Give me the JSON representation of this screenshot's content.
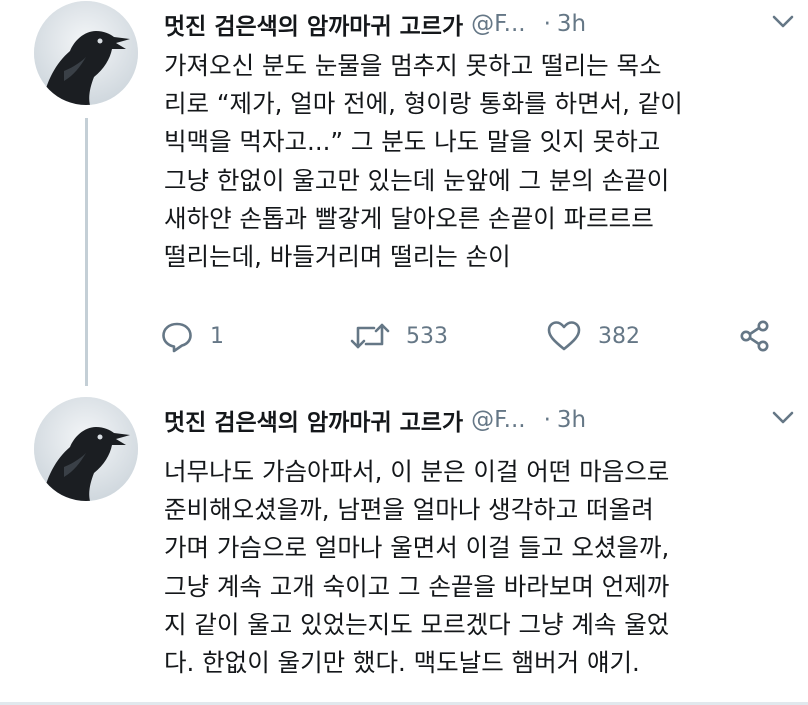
{
  "tweets": [
    {
      "display_name": "멋진 검은색의 암까마귀 고르가",
      "handle": "@F...",
      "separator": "·",
      "time": "3h",
      "text": "가져오신 분도 눈물을 멈추지 못하고 떨리는 목소\n리로 “제가, 얼마 전에, 형이랑 통화를 하면서, 같이\n빅맥을 먹자고...” 그 분도 나도 말을 잇지 못하고\n그냥 한없이 울고만 있는데 눈앞에 그 분의 손끝이\n새하얀 손톱과 빨갛게 달아오른 손끝이 파르르르\n떨리는데, 바들거리며 떨리는 손이",
      "replies": "1",
      "retweets": "533",
      "likes": "382",
      "icons": {
        "avatar": "raven-avatar",
        "menu": "chevron-down-icon",
        "reply": "reply-icon",
        "retweet": "retweet-icon",
        "like": "heart-icon",
        "share": "share-icon"
      }
    },
    {
      "display_name": "멋진 검은색의 암까마귀 고르가",
      "handle": "@F...",
      "separator": "·",
      "time": "3h",
      "text": "너무나도 가슴아파서, 이 분은 이걸 어떤 마음으로\n준비해오셨을까, 남편을 얼마나 생각하고 떠올려\n가며 가슴으로 얼마나 울면서 이걸 들고 오셨을까,\n그냥 계속 고개 숙이고 그 손끝을 바라보며 언제까\n지 같이 울고 있었는지도 모르겠다 그냥 계속 울었\n다. 한없이 울기만 했다. 맥도날드 햄버거 얘기."
    }
  ],
  "colors": {
    "text": "#14171a",
    "secondary": "#657786",
    "thread_line": "#c4cfd6",
    "background": "#ffffff"
  }
}
